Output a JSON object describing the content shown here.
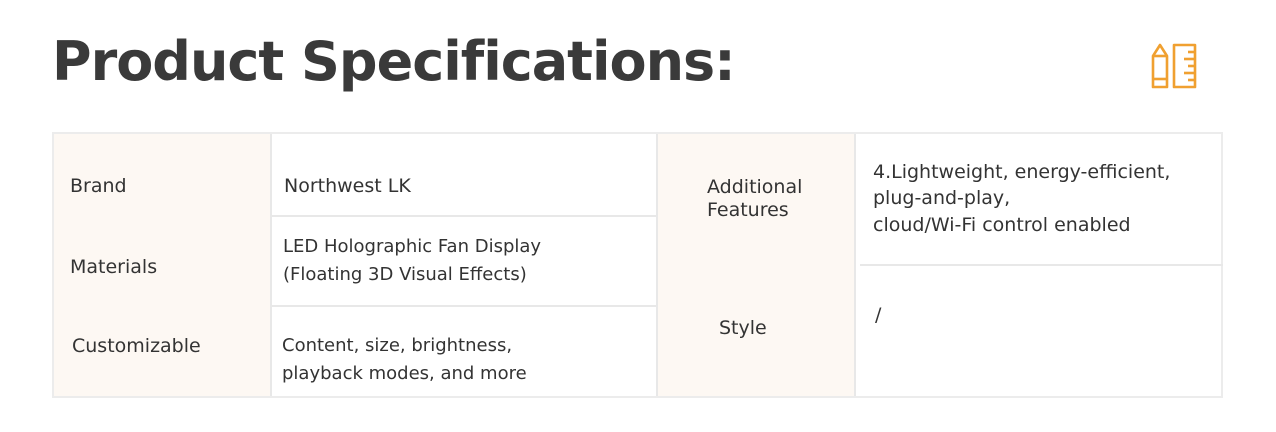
{
  "header": {
    "title": "Product Specifications:",
    "icon": "pencil-ruler-icon",
    "accent_color": "#f0a030"
  },
  "specs": {
    "brand": {
      "label": "Brand",
      "value": "Northwest LK"
    },
    "materials": {
      "label": "Materials",
      "value_line1": "LED Holographic Fan Display",
      "value_line2": "(Floating 3D Visual Effects)"
    },
    "customizable": {
      "label": "Customizable",
      "value_line1": "Content, size, brightness,",
      "value_line2": "playback modes, and more"
    },
    "additional_features": {
      "label_line1": "Additional",
      "label_line2": "Features",
      "value_line1": "4.Lightweight, energy-efficient,",
      "value_line2": "plug-and-play,",
      "value_line3": "cloud/Wi-Fi control enabled"
    },
    "style": {
      "label": "Style",
      "value": "/"
    }
  }
}
